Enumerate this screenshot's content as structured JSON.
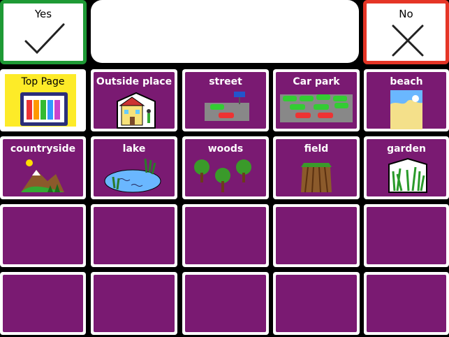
{
  "yes_label": "Yes",
  "no_label": "No",
  "message_text": "",
  "cells": {
    "top_page": "Top Page",
    "outside_place": "Outside place",
    "street": "street",
    "car_park": "Car park",
    "beach": "beach",
    "countryside": "countryside",
    "lake": "lake",
    "woods": "woods",
    "field": "field",
    "garden": "garden"
  },
  "colors": {
    "tile": "#7a1a72",
    "yes_border": "#1e9a35",
    "no_border": "#e53526",
    "top_page_bg": "#fdeb28"
  }
}
